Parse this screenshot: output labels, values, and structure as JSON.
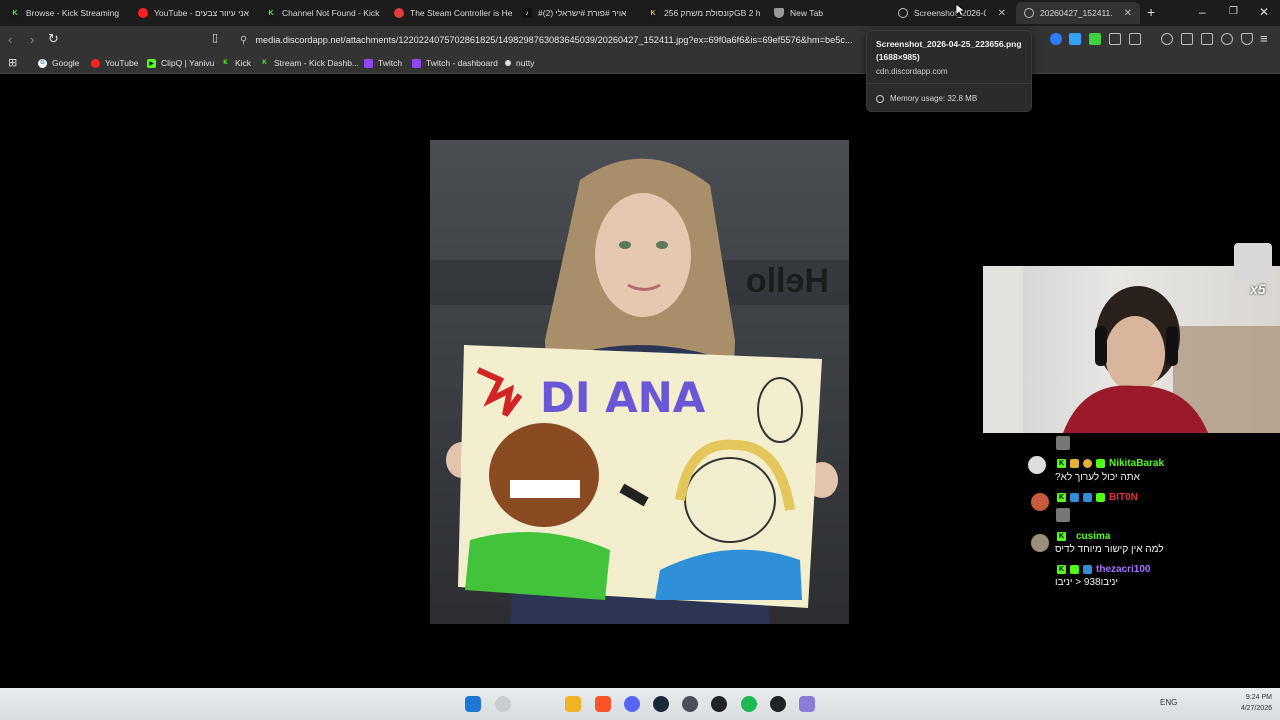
{
  "tabs": [
    {
      "title": "Browse - Kick Streaming",
      "icon": "kick-icon"
    },
    {
      "title": "YouTube - אני עיוור צבעים",
      "icon": "youtube-icon"
    },
    {
      "title": "Channel Not Found - Kick",
      "icon": "kick-icon"
    },
    {
      "title": "The Steam Controller is He",
      "icon": "youtube-icon"
    },
    {
      "title": "#אויר #פורת #ישראלי (2)",
      "icon": "tiktok-icon"
    },
    {
      "title": "קונסולת משחק 256GB 2 h",
      "icon": "kick-icon"
    },
    {
      "title": "New Tab",
      "icon": "shield-icon"
    },
    {
      "title": "Screenshot_2026-04-",
      "icon": "globe-icon"
    },
    {
      "title": "20260427_152411.jpg",
      "icon": "globe-icon"
    }
  ],
  "toolbar": {
    "url": "media.discordapp.net/attachments/1220224075702861825/1498298763083645039/20260427_152411.jpg?ex=69f0a6f6&is=69ef5576&hm=be5c..."
  },
  "bookmarks": [
    {
      "label": "Google",
      "icon": "google-icon"
    },
    {
      "label": "YouTube",
      "icon": "youtube-icon"
    },
    {
      "label": "ClipQ | Yanivu",
      "icon": "clipq-icon"
    },
    {
      "label": "Kick",
      "icon": "kick-icon"
    },
    {
      "label": "Stream - Kick Dashb...",
      "icon": "kick-icon"
    },
    {
      "label": "Twitch",
      "icon": "twitch-icon"
    },
    {
      "label": "Twitch - dashboard",
      "icon": "twitch-icon"
    },
    {
      "label": "nutty",
      "icon": "nutty-icon"
    }
  ],
  "hovercard": {
    "title": "Screenshot_2026-04-25_223656.png",
    "dimensions": "(1688×985)",
    "domain": "cdn.discordapp.com",
    "memory": "Memory usage: 32.8 MB"
  },
  "photo": {
    "sign_text": "DI ANA"
  },
  "badge": {
    "multiplier": "x5"
  },
  "chat": [
    {
      "user": "NikitaBarak",
      "color": "#53fc18",
      "message": "?אתה יכול לערוך לא"
    },
    {
      "user": "BIT0N",
      "color": "#e0323a",
      "message": ""
    },
    {
      "user": "cusima",
      "color": "#53fc18",
      "message": "למה אין קישור מיוחד לדיס"
    },
    {
      "user": "thezacri100",
      "color": "#a970ff",
      "message": "יניבו938 < יניבו"
    }
  ],
  "tray": {
    "language": "ENG",
    "time": "9:24 PM",
    "date": "4/27/2026"
  },
  "colors": {
    "accent_kick": "#53fc18",
    "tab_strip": "#1c1c1c",
    "toolbar": "#333333"
  }
}
